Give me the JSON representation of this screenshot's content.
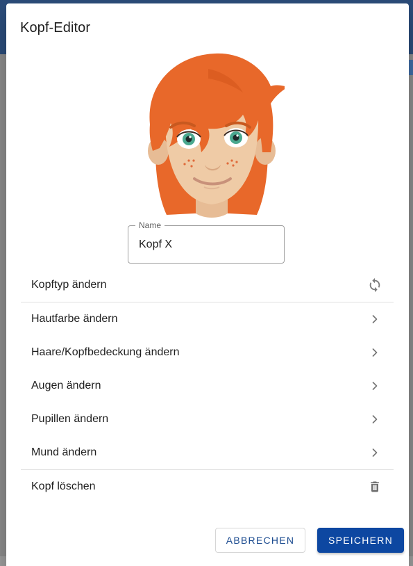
{
  "dialog": {
    "title": "Kopf-Editor"
  },
  "name_field": {
    "label": "Name",
    "value": "Kopf X"
  },
  "menu": {
    "items": [
      {
        "label": "Kopftyp ändern",
        "icon": "refresh-icon"
      },
      {
        "label": "Hautfarbe ändern",
        "icon": "chevron-right-icon"
      },
      {
        "label": "Haare/Kopfbedeckung ändern",
        "icon": "chevron-right-icon"
      },
      {
        "label": "Augen ändern",
        "icon": "chevron-right-icon"
      },
      {
        "label": "Pupillen ändern",
        "icon": "chevron-right-icon"
      },
      {
        "label": "Mund ändern",
        "icon": "chevron-right-icon"
      },
      {
        "label": "Kopf löschen",
        "icon": "trash-icon"
      }
    ]
  },
  "actions": {
    "cancel_label": "ABBRECHEN",
    "save_label": "SPEICHERN"
  },
  "colors": {
    "primary": "#0d47a1",
    "hair": "#e8682a",
    "skin": "#efcba6",
    "eye": "#4aa88f"
  }
}
